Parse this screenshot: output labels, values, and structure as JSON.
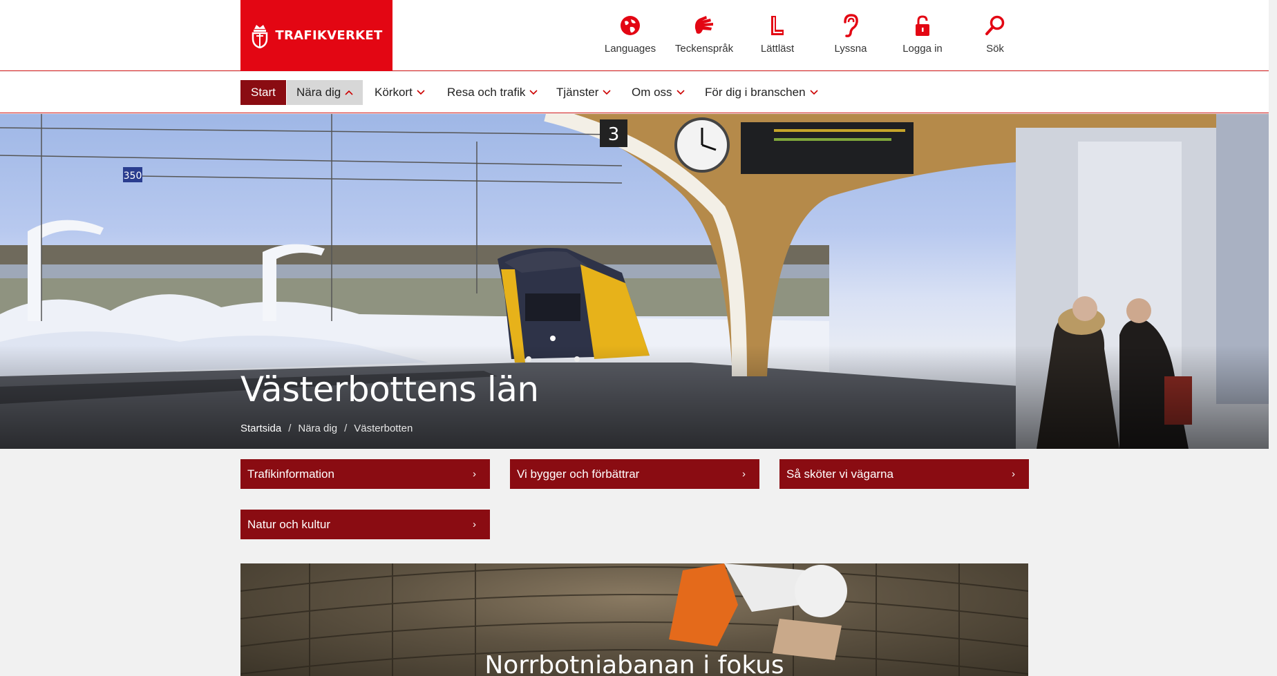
{
  "header": {
    "logo_text": "TRAFIKVERKET",
    "utilities": [
      {
        "label": "Languages",
        "icon": "globe-icon"
      },
      {
        "label": "Teckenspråk",
        "icon": "sign-language-icon"
      },
      {
        "label": "Lättläst",
        "icon": "easy-read-icon"
      },
      {
        "label": "Lyssna",
        "icon": "listen-icon"
      },
      {
        "label": "Logga in",
        "icon": "lock-icon"
      },
      {
        "label": "Sök",
        "icon": "search-icon"
      }
    ]
  },
  "nav": {
    "start": "Start",
    "items": [
      {
        "label": "Nära dig",
        "expanded": true
      },
      {
        "label": "Körkort",
        "expanded": false
      },
      {
        "label": "Resa och trafik",
        "expanded": false
      },
      {
        "label": "Tjänster",
        "expanded": false
      },
      {
        "label": "Om oss",
        "expanded": false
      },
      {
        "label": "För dig i branschen",
        "expanded": false
      }
    ]
  },
  "hero": {
    "title": "Västerbottens län",
    "breadcrumbs": [
      "Startsida",
      "Nära dig",
      "Västerbotten"
    ],
    "sign_350": "350",
    "track_sign": "3"
  },
  "quick_links": [
    "Trafikinformation",
    "Vi bygger och förbättrar",
    "Så sköter vi vägarna",
    "Natur och kultur"
  ],
  "feature": {
    "title": "Norrbotniabanan i fokus"
  },
  "colors": {
    "brand_red": "#e30613",
    "dark_red": "#8a0c12",
    "nav_active": "#d7d7d7"
  }
}
